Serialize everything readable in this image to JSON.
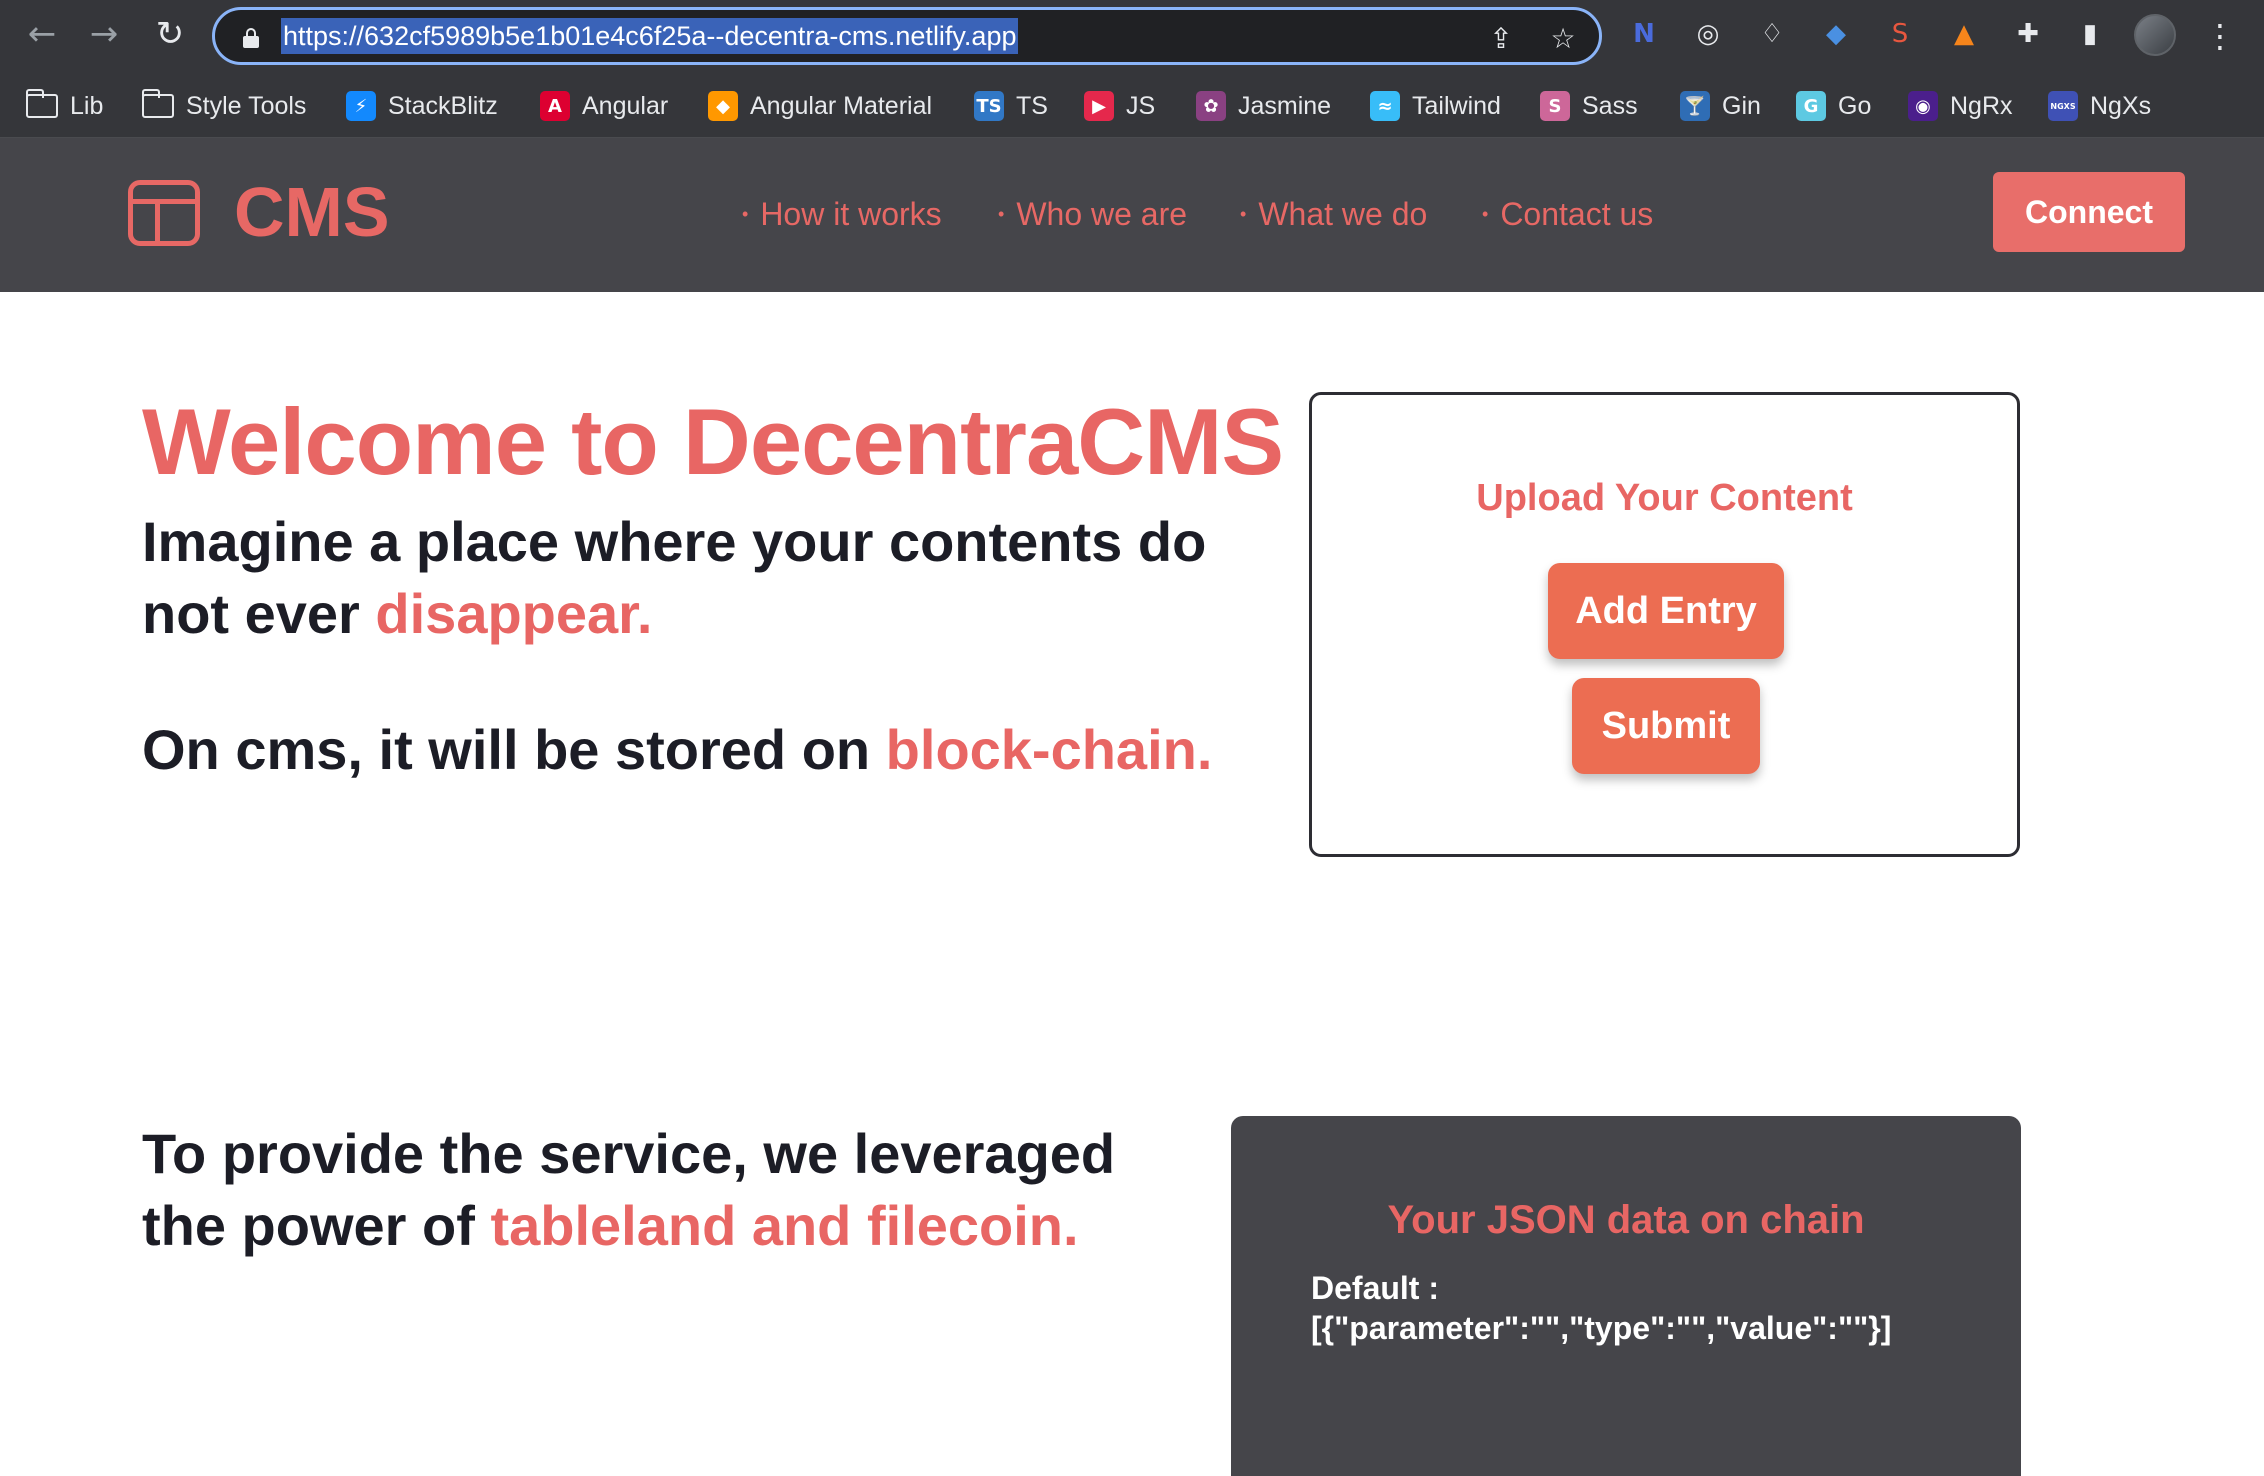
{
  "browser": {
    "url": "https://632cf5989b5e1b01e4c6f25a--decentra-cms.netlify.app",
    "bookmarks": [
      {
        "label": "Lib",
        "icon": "folder-icon"
      },
      {
        "label": "Style Tools",
        "icon": "folder-icon"
      },
      {
        "label": "StackBlitz",
        "icon": "stackblitz-icon",
        "color": "#1389fd",
        "glyph": "⚡"
      },
      {
        "label": "Angular",
        "icon": "angular-icon",
        "color": "#dd0031",
        "glyph": "A"
      },
      {
        "label": "Angular Material",
        "icon": "angular-material-icon",
        "color": "#ff9800",
        "glyph": "◆"
      },
      {
        "label": "TS",
        "icon": "typescript-icon",
        "color": "#3178c6",
        "glyph": "TS"
      },
      {
        "label": "JS",
        "icon": "js-icon",
        "color": "#e5284c",
        "glyph": "▶"
      },
      {
        "label": "Jasmine",
        "icon": "jasmine-icon",
        "color": "#8a4182",
        "glyph": "✿"
      },
      {
        "label": "Tailwind",
        "icon": "tailwind-icon",
        "color": "#38bdf8",
        "glyph": "≈"
      },
      {
        "label": "Sass",
        "icon": "sass-icon",
        "color": "#cd6799",
        "glyph": "S"
      },
      {
        "label": "Gin",
        "icon": "gin-icon",
        "color": "#2f6db5",
        "glyph": "🍸"
      },
      {
        "label": "Go",
        "icon": "go-icon",
        "color": "#5dc9e2",
        "glyph": "G"
      },
      {
        "label": "NgRx",
        "icon": "ngrx-icon",
        "color": "#4b1f8c",
        "glyph": "◉"
      },
      {
        "label": "NgXs",
        "icon": "ngxs-icon",
        "color": "#3f51b5",
        "glyph": "NGXS"
      }
    ]
  },
  "header": {
    "logo_text": "CMS",
    "nav": [
      "How it works",
      "Who we are",
      "What we do",
      "Contact us"
    ],
    "connect_label": "Connect",
    "accent_color": "#e76865",
    "background": "#45454a"
  },
  "hero": {
    "title": "Welcome to DecentraCMS",
    "line1": "Imagine a place where your contents do",
    "line2_prefix": "not ever ",
    "line2_accent": "disappear.",
    "line3_prefix": "On cms, it will be stored on ",
    "line3_accent": "block-chain."
  },
  "upload": {
    "title": "Upload Your Content",
    "add_entry_label": "Add Entry",
    "submit_label": "Submit"
  },
  "service": {
    "line1": "To provide the service, we leveraged",
    "line2_prefix": "the power of ",
    "line2_accent": "tableland and filecoin."
  },
  "json_card": {
    "title": "Your JSON data on chain",
    "default_label": "Default :",
    "default_value": "[{\"parameter\":\"\",\"type\":\"\",\"value\":\"\"}]"
  }
}
